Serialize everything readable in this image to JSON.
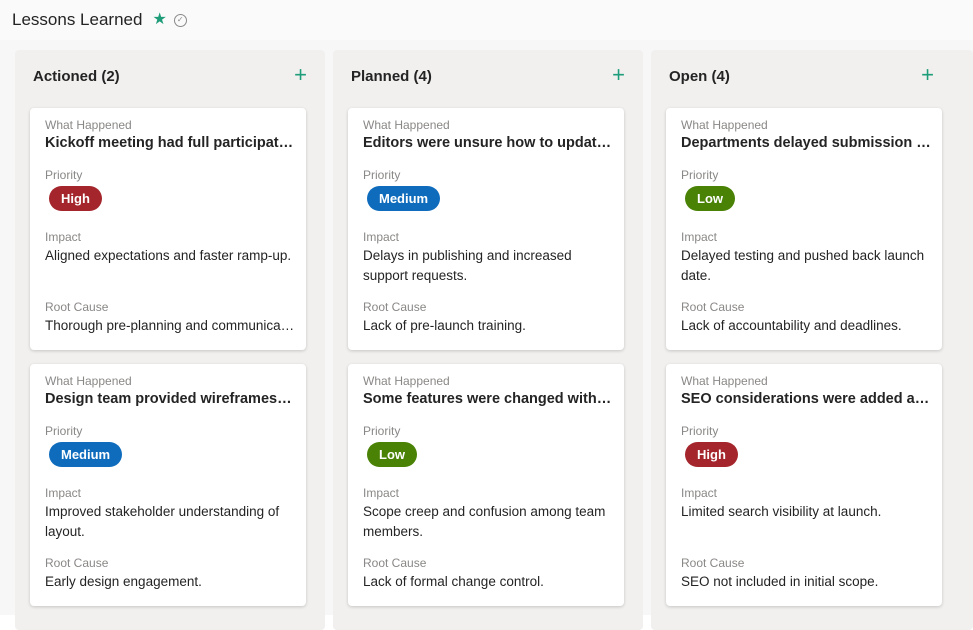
{
  "header": {
    "title": "Lessons Learned",
    "star_icon": "★",
    "check_icon": "✓"
  },
  "labels": {
    "what": "What Happened",
    "priority": "Priority",
    "impact": "Impact",
    "root": "Root Cause"
  },
  "priority_colors": {
    "High": "#a4262c",
    "Medium": "#0f6cbd",
    "Low": "#498205"
  },
  "columns": [
    {
      "name": "Actioned",
      "count": "(2)",
      "add": "+",
      "cards": [
        {
          "title": "Kickoff meeting had full participation",
          "priority": "High",
          "impact": "Aligned expectations and faster ramp-up.",
          "root": "Thorough pre-planning and communication"
        },
        {
          "title": "Design team provided wireframes early",
          "priority": "Medium",
          "impact": "Improved stakeholder understanding of layout.",
          "root": "Early design engagement."
        }
      ]
    },
    {
      "name": "Planned",
      "count": "(4)",
      "add": "+",
      "cards": [
        {
          "title": "Editors were unsure how to update content",
          "priority": "Medium",
          "impact": "Delays in publishing and increased support requests.",
          "root": "Lack of pre-launch training."
        },
        {
          "title": "Some features were changed without notice",
          "priority": "Low",
          "impact": "Scope creep and confusion among team members.",
          "root": "Lack of formal change control."
        }
      ]
    },
    {
      "name": "Open",
      "count": "(4)",
      "add": "+",
      "cards": [
        {
          "title": "Departments delayed submission of content",
          "priority": "Low",
          "impact": "Delayed testing and pushed back launch date.",
          "root": "Lack of accountability and deadlines."
        },
        {
          "title": "SEO considerations were added after launch",
          "priority": "High",
          "impact": "Limited search visibility at launch.",
          "root": "SEO not included in initial scope."
        }
      ]
    }
  ]
}
